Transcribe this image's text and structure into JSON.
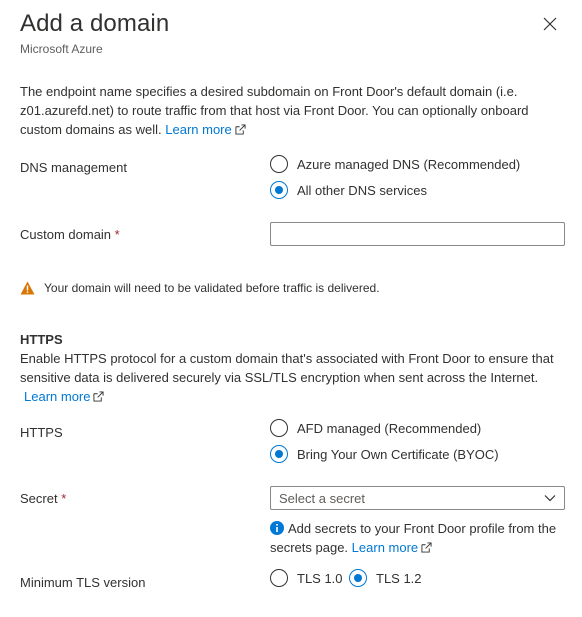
{
  "header": {
    "title": "Add a domain",
    "subtitle": "Microsoft Azure",
    "close_icon": "close-icon"
  },
  "intro": {
    "text": "The endpoint name specifies a desired subdomain on Front Door's default domain (i.e. z01.azurefd.net) to route traffic from that host via Front Door. You can optionally onboard custom domains as well.",
    "link": "Learn more"
  },
  "dns": {
    "label": "DNS management",
    "options": [
      {
        "label": "Azure managed DNS (Recommended)",
        "checked": false
      },
      {
        "label": "All other DNS services",
        "checked": true
      }
    ]
  },
  "custom_domain": {
    "label": "Custom domain",
    "required_marker": "*",
    "value": "",
    "placeholder": ""
  },
  "warning": {
    "icon": "warning-icon",
    "text": "Your domain will need to be validated before traffic is delivered."
  },
  "https_section": {
    "title": "HTTPS",
    "description": "Enable HTTPS protocol for a custom domain that's associated with Front Door to ensure that sensitive data is delivered securely via SSL/TLS encryption when sent across the Internet.",
    "link": "Learn more"
  },
  "https": {
    "label": "HTTPS",
    "options": [
      {
        "label": "AFD managed (Recommended)",
        "checked": false
      },
      {
        "label": "Bring Your Own Certificate (BYOC)",
        "checked": true
      }
    ]
  },
  "secret": {
    "label": "Secret",
    "required_marker": "*",
    "placeholder": "Select a secret",
    "info_text": "Add secrets to your Front Door profile from the secrets page.",
    "info_link": "Learn more"
  },
  "tls": {
    "label": "Minimum TLS version",
    "options": [
      {
        "label": "TLS 1.0",
        "checked": false
      },
      {
        "label": "TLS 1.2",
        "checked": true
      }
    ]
  },
  "colors": {
    "accent": "#0078d4",
    "warning": "#d97706",
    "required": "#a4262c",
    "text": "#323130"
  }
}
